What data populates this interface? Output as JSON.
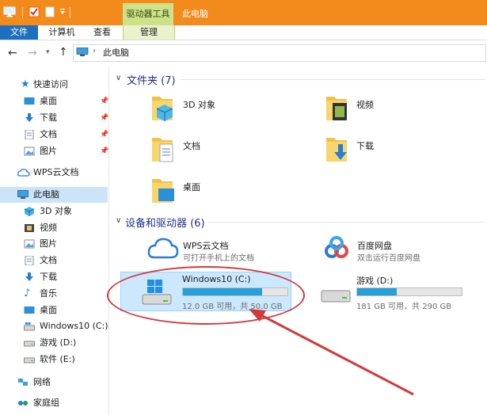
{
  "title_bar": {
    "context_tab_header": "驱动器工具",
    "window_title": "此电脑"
  },
  "ribbon": {
    "tabs": [
      "文件",
      "计算机",
      "查看",
      "管理"
    ]
  },
  "address_bar": {
    "path": "此电脑"
  },
  "nav_pane": {
    "quick_access": "快速访问",
    "quick_items": [
      {
        "label": "桌面",
        "icon": "desktop-icon"
      },
      {
        "label": "下载",
        "icon": "download-icon"
      },
      {
        "label": "文档",
        "icon": "documents-icon"
      },
      {
        "label": "图片",
        "icon": "pictures-icon"
      }
    ],
    "wps_cloud": "WPS云文档",
    "this_pc": "此电脑",
    "pc_items": [
      {
        "label": "3D 对象",
        "icon": "3d-objects-icon"
      },
      {
        "label": "视频",
        "icon": "videos-icon"
      },
      {
        "label": "图片",
        "icon": "pictures-icon"
      },
      {
        "label": "文档",
        "icon": "documents-icon"
      },
      {
        "label": "下载",
        "icon": "download-icon"
      },
      {
        "label": "音乐",
        "icon": "music-icon"
      },
      {
        "label": "桌面",
        "icon": "desktop-icon"
      },
      {
        "label": "Windows10 (C:)",
        "icon": "drive-c-icon"
      },
      {
        "label": "游戏 (D:)",
        "icon": "drive-icon"
      },
      {
        "label": "软件 (E:)",
        "icon": "drive-icon"
      }
    ],
    "network": "网络",
    "homegroup": "家庭组"
  },
  "content": {
    "folders_header": "文件夹 (7)",
    "folders": [
      "3D 对象",
      "视频",
      "文档",
      "下载",
      "桌面"
    ],
    "devices_header": "设备和驱动器 (6)",
    "wps": {
      "title": "WPS云文档",
      "subtitle": "可打开手机上的文档"
    },
    "baidu": {
      "title": "百度网盘",
      "subtitle": "双击运行百度网盘"
    },
    "drive_c": {
      "title": "Windows10 (C:)",
      "space": "12.0 GB 可用，共 50.0 GB",
      "used_fraction": 0.76
    },
    "drive_d": {
      "title": "游戏 (D:)",
      "space": "181 GB 可用，共 290 GB",
      "used_fraction": 0.38
    }
  },
  "colors": {
    "title_bar": "#f28a1c",
    "context_tab": "#cfe08a",
    "file_tab": "#1d6fbf",
    "progress": "#26a0da",
    "selection": "#cce8ff",
    "annotation": "#d23a3a"
  }
}
